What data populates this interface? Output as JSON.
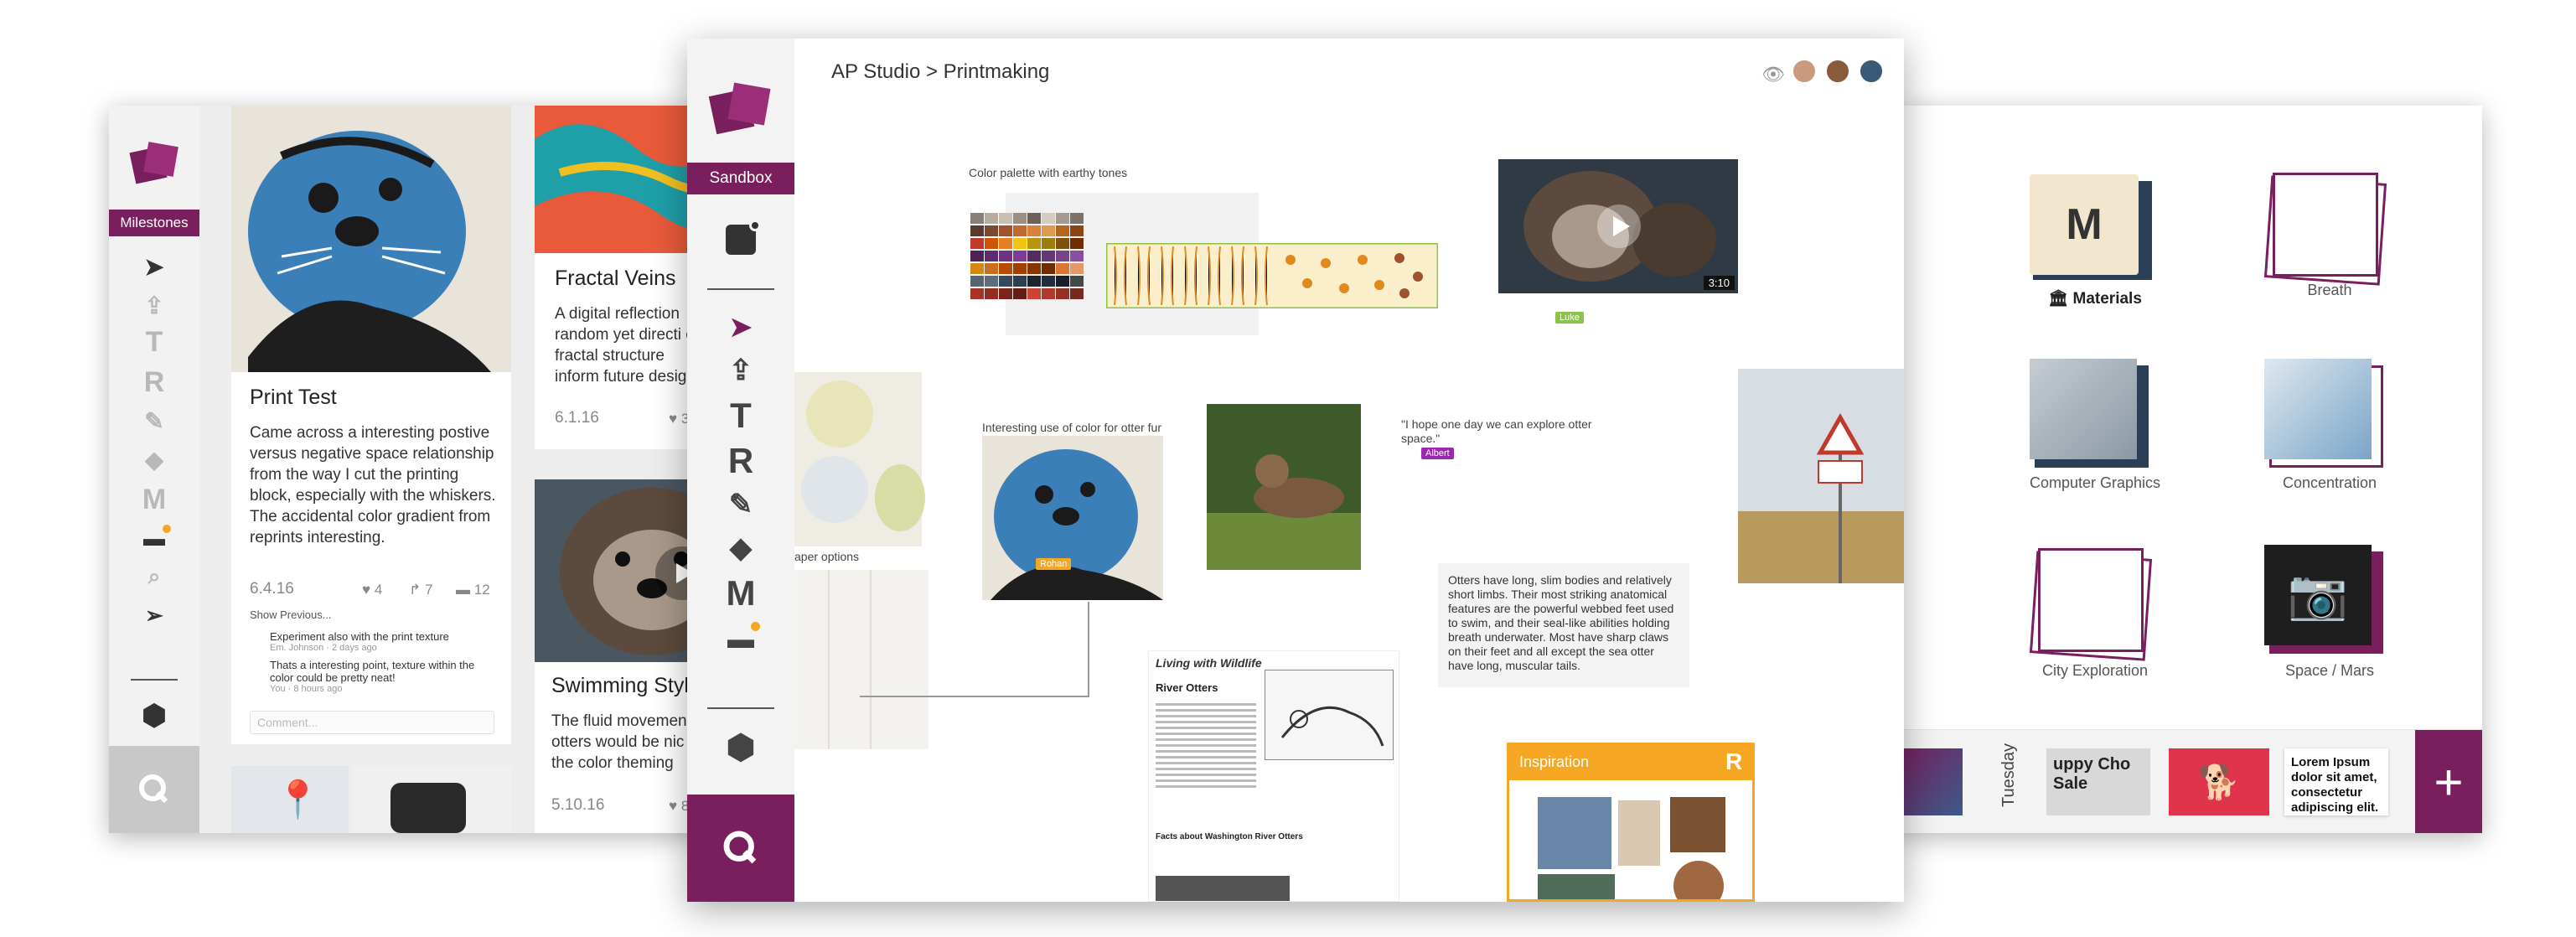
{
  "left_window": {
    "sidebar_tag": "Milestones",
    "tools": [
      "arrow-icon",
      "upload-icon",
      "T",
      "R",
      "pen-icon",
      "shapes-icon",
      "M",
      "comment-icon",
      "search-icon",
      "send-icon",
      "hexagon-icon"
    ],
    "cards": {
      "print_test": {
        "title": "Print Test",
        "body": "Came across a interesting postive versus negative space relationship from the way I cut the printing block, especially with the whiskers. The accidental color gradient from reprints interesting.",
        "date": "6.4.16",
        "likes": "4",
        "shares": "7",
        "comments": "12",
        "show_previous": "Show Previous...",
        "comment1": {
          "text": "Experiment also with the print texture",
          "meta": "Em. Johnson · 2 days ago"
        },
        "comment2": {
          "text": "Thats a interesting point, texture within the color could be pretty neat!",
          "meta": "You · 8 hours ago"
        },
        "comment_placeholder": "Comment..."
      },
      "fractal": {
        "title": "Fractal Veins",
        "body": "A digital reflection random yet directi of fractal structure inform future desig",
        "date": "6.1.16",
        "likes": "3"
      },
      "swimming": {
        "title": "Swimming Style",
        "body": "The fluid movement otters would be nic in the color theming",
        "date": "5.10.16",
        "likes": "8"
      }
    }
  },
  "center_window": {
    "sidebar_tag": "Sandbox",
    "breadcrumb": {
      "root": "AP Studio",
      "separator": ">",
      "current": "Printmaking"
    },
    "canvas": {
      "palette_label": "Color palette with earthy tones",
      "luke_tag": "Luke",
      "video_duration": "3:10",
      "paper_options": "aper options",
      "otter_fur_label": "Interesting use of color for otter fur",
      "rohan_tag": "Rohan",
      "quote": "\"I hope one day we can explore otter space.\"",
      "albert_tag": "Albert",
      "facts": "Otters have long, slim bodies and relatively short limbs. Their most striking anatomical features are the powerful webbed feet used to swim, and their seal-like abilities holding breath underwater. Most have sharp claws on their feet and all except the sea otter have long, muscular tails.",
      "doc_title": "Living with Wildlife",
      "doc_heading": "River Otters",
      "doc_facts": "Facts about Washington River Otters",
      "inspiration": "Inspiration",
      "inspiration_badge": "R"
    },
    "colors": {
      "accent": "#7a1f5e",
      "inspiration": "#f5a623",
      "sign": "#c0392b"
    }
  },
  "right_window": {
    "folders": [
      {
        "label": "Materials",
        "letter": "M"
      },
      {
        "label": "Breath"
      },
      {
        "label": "Computer Graphics"
      },
      {
        "label": "Concentration"
      },
      {
        "label": "City Exploration"
      },
      {
        "label": "Space / Mars"
      }
    ],
    "bottom_bar": {
      "day": "Tuesday",
      "sale_text": "uppy Cho Sale",
      "lorem": "Lorem Ipsum dolor sit amet, consectetur adipiscing elit.",
      "add": "+"
    }
  }
}
